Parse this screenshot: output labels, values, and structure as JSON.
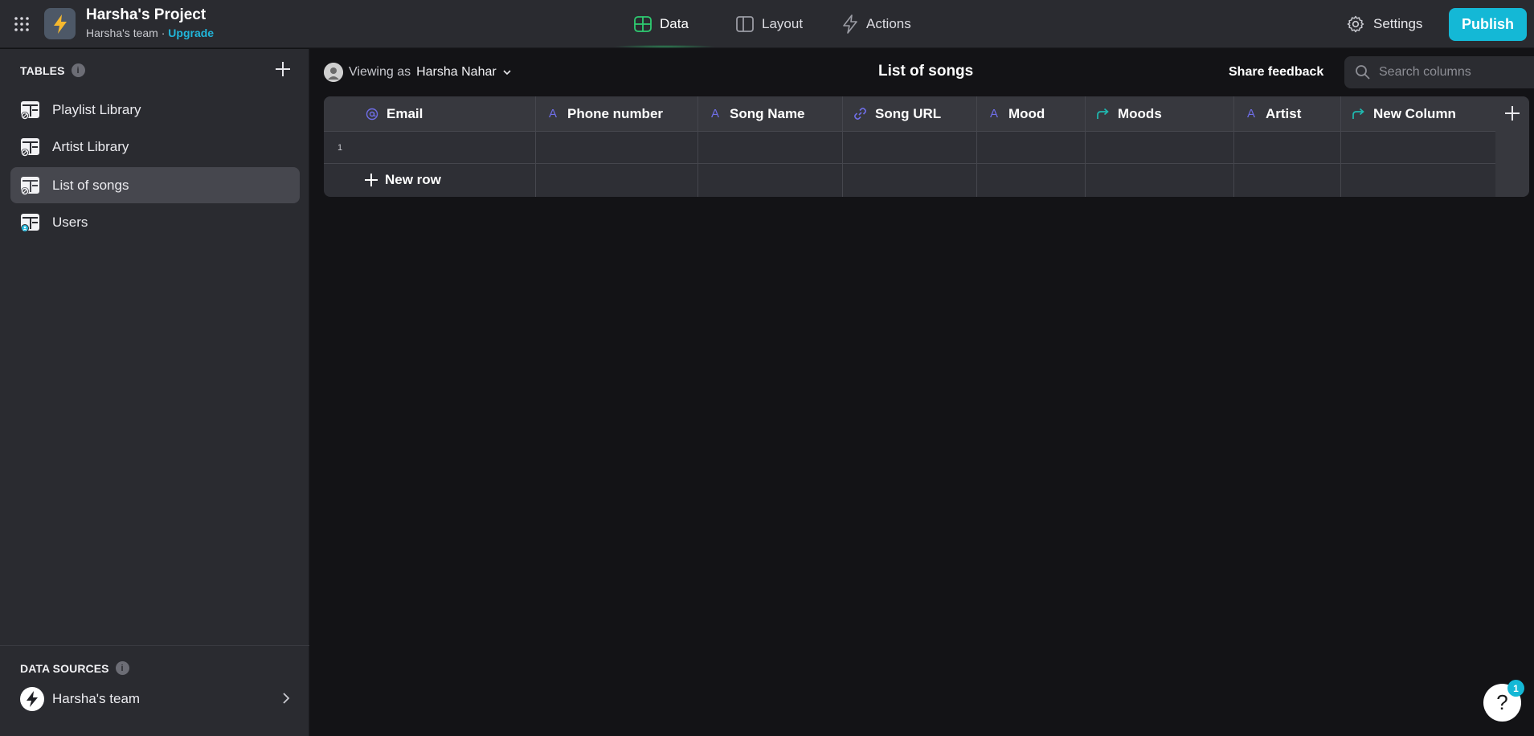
{
  "header": {
    "project_title": "Harsha's Project",
    "team_name": "Harsha's team",
    "separator": "·",
    "upgrade_label": "Upgrade",
    "tabs": [
      {
        "label": "Data",
        "icon": "table-icon",
        "active": true
      },
      {
        "label": "Layout",
        "icon": "layout-icon",
        "active": false
      },
      {
        "label": "Actions",
        "icon": "lightning-icon",
        "active": false
      }
    ],
    "settings_label": "Settings",
    "publish_label": "Publish"
  },
  "sidebar": {
    "tables_header": "TABLES",
    "tables": [
      {
        "label": "Playlist Library",
        "active": false
      },
      {
        "label": "Artist Library",
        "active": false
      },
      {
        "label": "List of songs",
        "active": true
      },
      {
        "label": "Users",
        "active": false
      }
    ],
    "data_sources_header": "DATA SOURCES",
    "data_source": {
      "label": "Harsha's team"
    }
  },
  "main": {
    "viewing_prefix": "Viewing as",
    "viewing_user": "Harsha Nahar",
    "title": "List of songs",
    "share_feedback": "Share feedback",
    "search_placeholder": "Search columns",
    "columns": [
      {
        "label": "Email",
        "type_icon": "email-icon"
      },
      {
        "label": "Phone number",
        "type_icon": "text-icon"
      },
      {
        "label": "Song Name",
        "type_icon": "text-icon"
      },
      {
        "label": "Song URL",
        "type_icon": "link-icon"
      },
      {
        "label": "Mood",
        "type_icon": "text-icon"
      },
      {
        "label": "Moods",
        "type_icon": "relation-icon"
      },
      {
        "label": "Artist",
        "type_icon": "text-icon"
      },
      {
        "label": "New Column",
        "type_icon": "relation-icon"
      }
    ],
    "row_number": "1",
    "new_row_label": "New row"
  },
  "help": {
    "label": "?",
    "badge": "1"
  },
  "colors": {
    "accent": "#14b8d6",
    "data_tab_active": "#2ecc71",
    "text_type_icon": "#6f6ee8",
    "relation_type_icon": "#1fb9b0",
    "sidebar_bg": "#2a2b30",
    "canvas_bg": "#131316"
  }
}
